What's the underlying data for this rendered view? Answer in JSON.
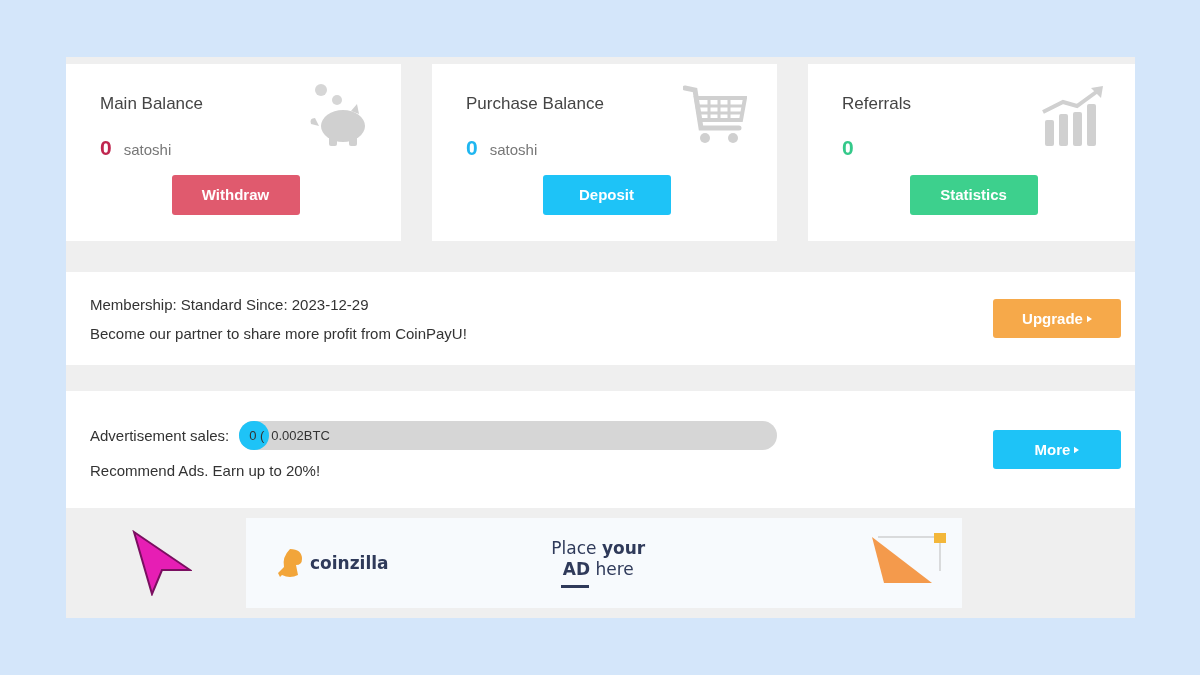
{
  "cards": [
    {
      "title": "Main Balance",
      "amount": "0",
      "unit": "satoshi",
      "color": "#c0264f",
      "kind": "piggy",
      "button": {
        "label": "Withdraw",
        "color": "#e05a6e"
      }
    },
    {
      "title": "Purchase Balance",
      "amount": "0",
      "unit": "satoshi",
      "color": "#1fb6f0",
      "kind": "cart",
      "button": {
        "label": "Deposit",
        "color": "#1ec3f7"
      }
    },
    {
      "title": "Referrals",
      "amount": "0",
      "color": "#34c98a",
      "kind": "chart",
      "button": {
        "label": "Statistics",
        "color": "#3dd08d"
      }
    }
  ],
  "membership": {
    "line": "Membership: Standard Since: 2023-12-29",
    "text": "Become our partner to share more profit from CoinPayU!",
    "button": "Upgrade"
  },
  "ads": {
    "label": "Advertisement sales:",
    "level": 0.05,
    "fill_text": "0 (",
    "bar_text": "0.002BTC",
    "text": "Recommend Ads. Earn up to 20%!",
    "button": "More"
  },
  "banner": {
    "brand": "coinzilla",
    "line1": "Place **your**",
    "line2": "**AD** here"
  }
}
